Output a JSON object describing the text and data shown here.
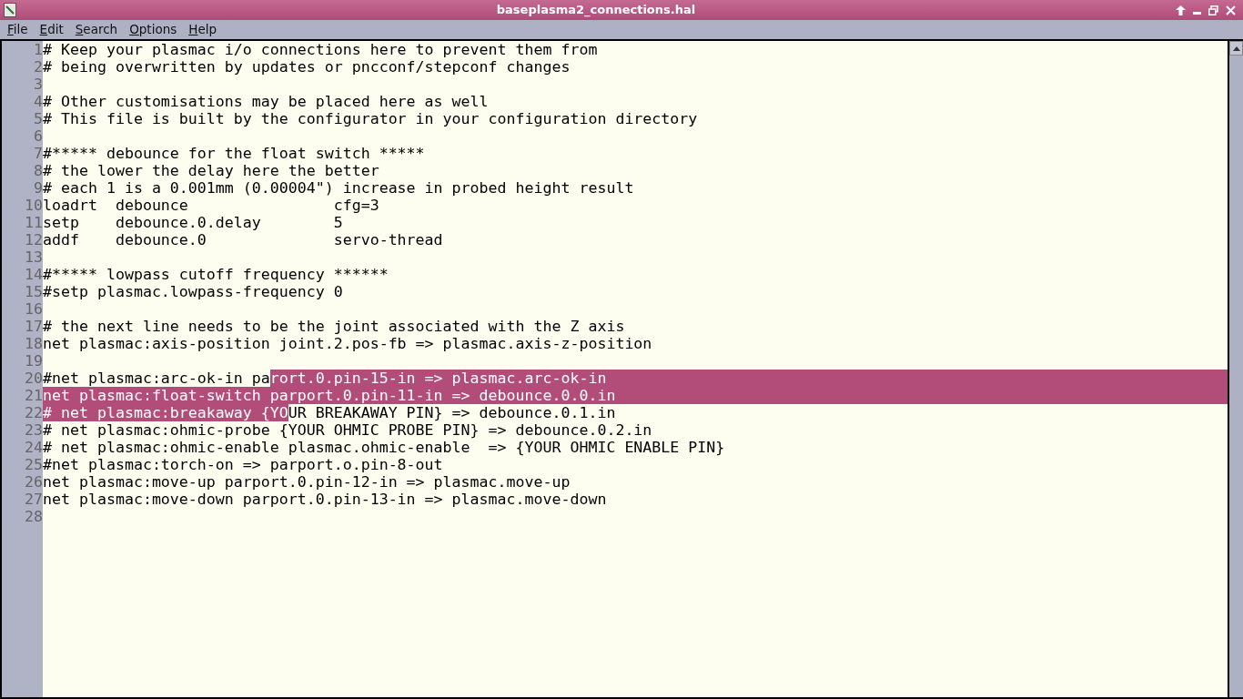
{
  "window": {
    "title": "baseplasma2_connections.hal"
  },
  "menu": [
    {
      "label": "File"
    },
    {
      "label": "Edit"
    },
    {
      "label": "Search"
    },
    {
      "label": "Options"
    },
    {
      "label": "Help"
    }
  ],
  "editor": {
    "lines": [
      {
        "number": "1",
        "parts": [
          {
            "text": "# Keep your plasmac i/o connections here to prevent them from",
            "selected": false
          }
        ],
        "eol_selected": false
      },
      {
        "number": "2",
        "parts": [
          {
            "text": "# being overwritten by updates or pncconf/stepconf changes",
            "selected": false
          }
        ],
        "eol_selected": false
      },
      {
        "number": "3",
        "eol_selected": false
      },
      {
        "number": "4",
        "parts": [
          {
            "text": "# Other customisations may be placed here as well",
            "selected": false
          }
        ],
        "eol_selected": false
      },
      {
        "number": "5",
        "parts": [
          {
            "text": "# This file is built by the configurator in your configuration directory",
            "selected": false
          }
        ],
        "eol_selected": false
      },
      {
        "number": "6",
        "eol_selected": false
      },
      {
        "number": "7",
        "parts": [
          {
            "text": "#***** debounce for the float switch *****",
            "selected": false
          }
        ],
        "eol_selected": false
      },
      {
        "number": "8",
        "parts": [
          {
            "text": "# the lower the delay here the better",
            "selected": false
          }
        ],
        "eol_selected": false
      },
      {
        "number": "9",
        "parts": [
          {
            "text": "# each 1 is a 0.001mm (0.00004\") increase in probed height result",
            "selected": false
          }
        ],
        "eol_selected": false
      },
      {
        "number": "10",
        "parts": [
          {
            "text": "loadrt  debounce                cfg=3",
            "selected": false
          }
        ],
        "eol_selected": false
      },
      {
        "number": "11",
        "parts": [
          {
            "text": "setp    debounce.0.delay        5",
            "selected": false
          }
        ],
        "eol_selected": false
      },
      {
        "number": "12",
        "parts": [
          {
            "text": "addf    debounce.0              servo-thread",
            "selected": false
          }
        ],
        "eol_selected": false
      },
      {
        "number": "13",
        "eol_selected": false
      },
      {
        "number": "14",
        "parts": [
          {
            "text": "#***** lowpass cutoff frequency ******",
            "selected": false
          }
        ],
        "eol_selected": false
      },
      {
        "number": "15",
        "parts": [
          {
            "text": "#setp plasmac.lowpass-frequency 0",
            "selected": false
          }
        ],
        "eol_selected": false
      },
      {
        "number": "16",
        "eol_selected": false
      },
      {
        "number": "17",
        "parts": [
          {
            "text": "# the next line needs to be the joint associated with the Z axis",
            "selected": false
          }
        ],
        "eol_selected": false
      },
      {
        "number": "18",
        "parts": [
          {
            "text": "net plasmac:axis-position joint.2.pos-fb => plasmac.axis-z-position",
            "selected": false
          }
        ],
        "eol_selected": false
      },
      {
        "number": "19",
        "eol_selected": false
      },
      {
        "number": "20",
        "parts": [
          {
            "text": "#net plasmac:arc-ok-in pa",
            "selected": false
          },
          {
            "text": "rort.0.pin-15-in => plasmac.arc-ok-in",
            "selected": true
          }
        ],
        "eol_selected": true
      },
      {
        "number": "21",
        "parts": [
          {
            "text": "net plasmac:float-switch parport.0.pin-11-in => debounce.0.0.in",
            "selected": true
          }
        ],
        "eol_selected": true
      },
      {
        "number": "22",
        "parts": [
          {
            "text": "# net plasmac:breakaway {YO",
            "selected": true
          },
          {
            "text": "UR BREAKAWAY PIN} => debounce.0.1.in",
            "selected": false
          }
        ],
        "eol_selected": false
      },
      {
        "number": "23",
        "parts": [
          {
            "text": "# net plasmac:ohmic-probe {YOUR OHMIC PROBE PIN} => debounce.0.2.in",
            "selected": false
          }
        ],
        "eol_selected": false
      },
      {
        "number": "24",
        "parts": [
          {
            "text": "# net plasmac:ohmic-enable plasmac.ohmic-enable  => {YOUR OHMIC ENABLE PIN}",
            "selected": false
          }
        ],
        "eol_selected": false
      },
      {
        "number": "25",
        "parts": [
          {
            "text": "#net plasmac:torch-on => parport.o.pin-8-out",
            "selected": false
          }
        ],
        "eol_selected": false
      },
      {
        "number": "26",
        "parts": [
          {
            "text": "net plasmac:move-up parport.0.pin-12-in => plasmac.move-up",
            "selected": false
          }
        ],
        "eol_selected": false
      },
      {
        "number": "27",
        "parts": [
          {
            "text": "net plasmac:move-down parport.0.pin-13-in => plasmac.move-down",
            "selected": false
          }
        ],
        "eol_selected": false
      },
      {
        "number": "28",
        "eol_selected": false
      }
    ]
  }
}
